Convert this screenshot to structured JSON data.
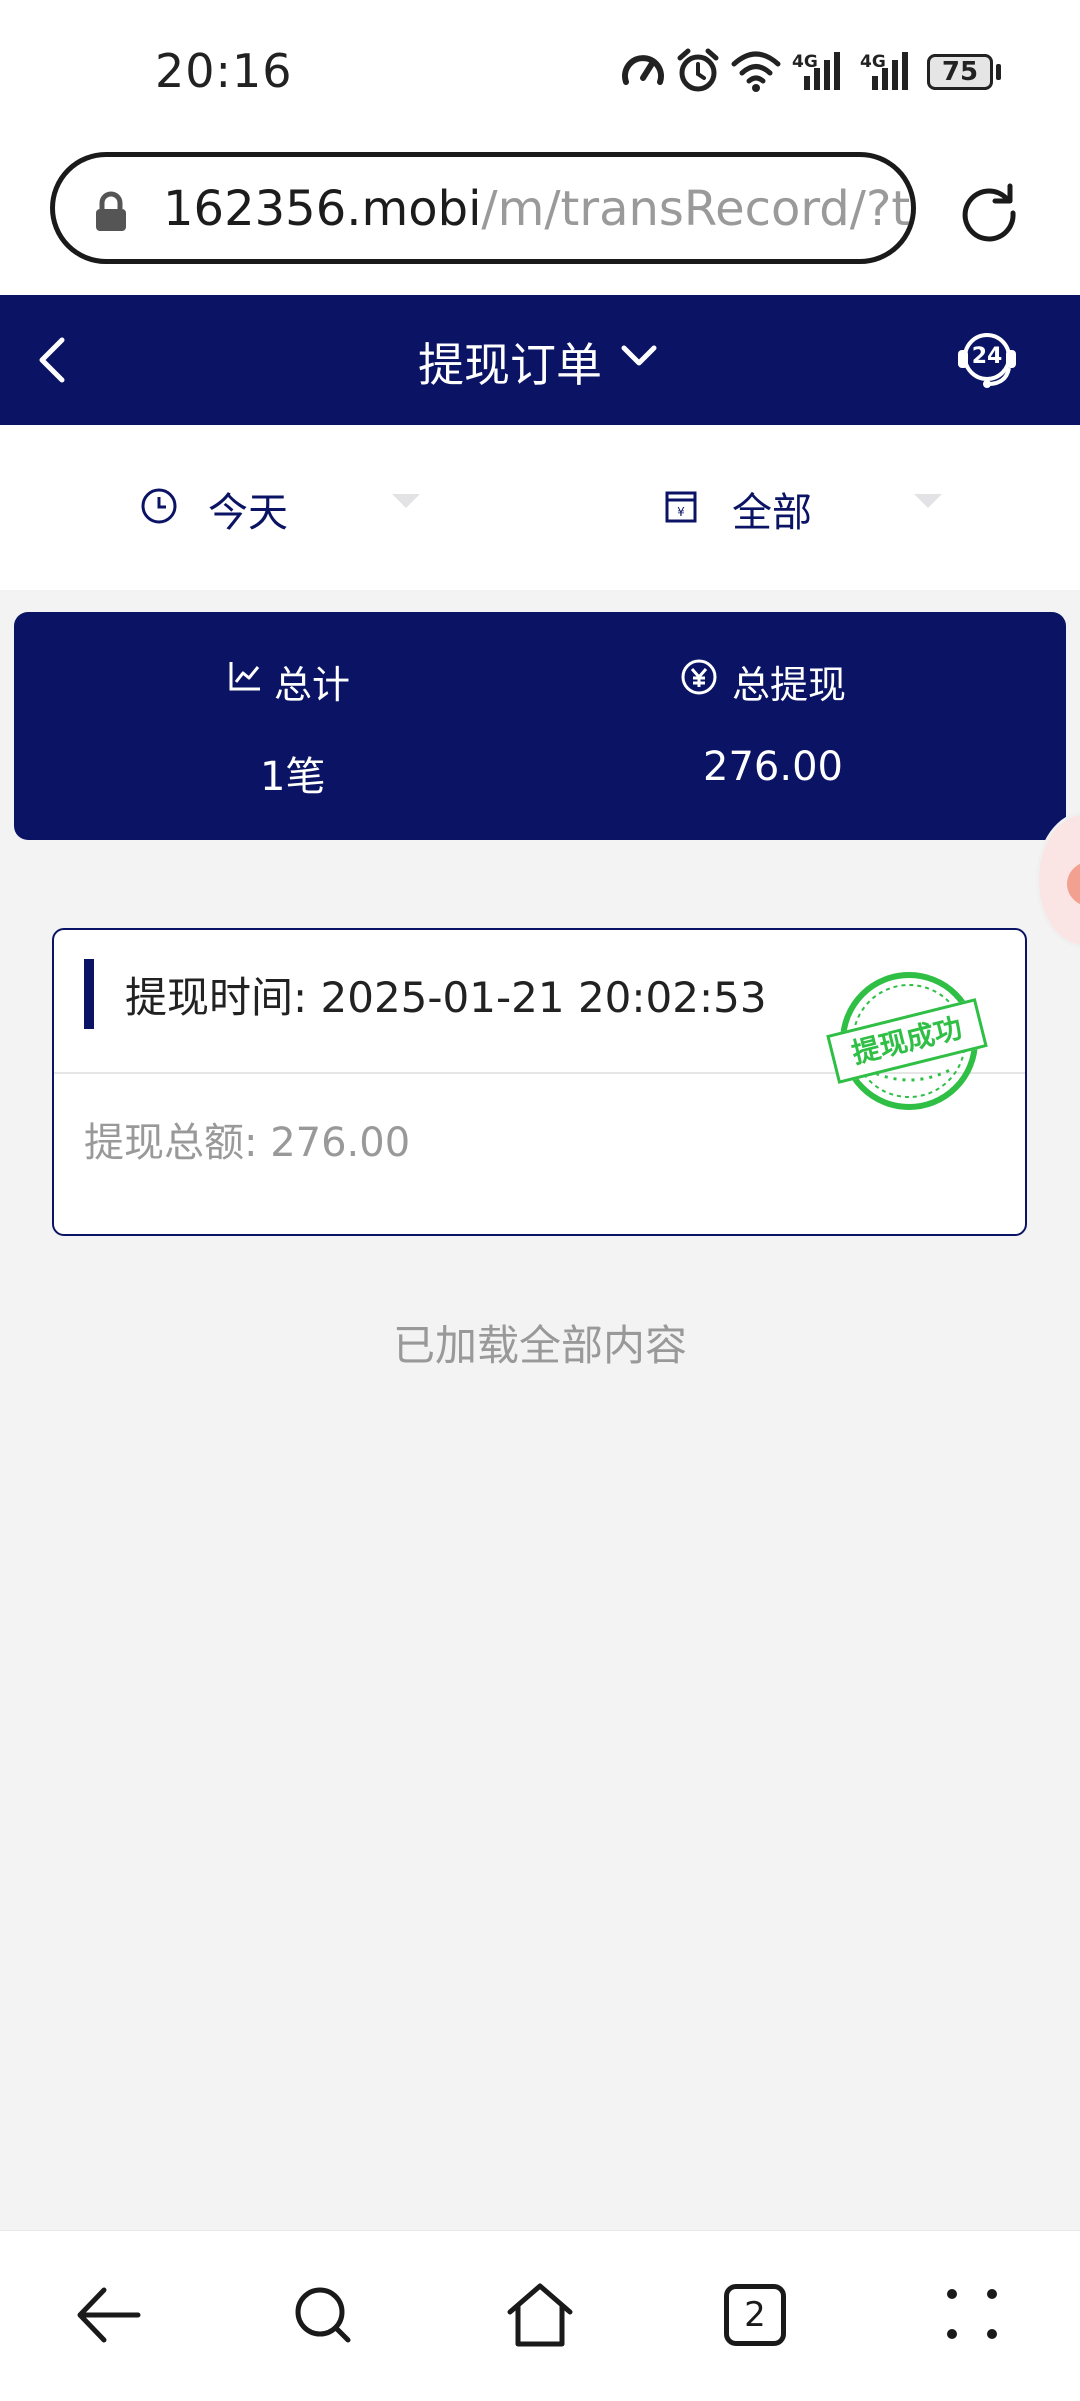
{
  "status_bar": {
    "time": "20:16",
    "network_1": "4G",
    "network_2": "4G",
    "battery": "75"
  },
  "browser": {
    "url_host": "162356.mobi",
    "url_path": "/m/transRecord/?type",
    "tab_count": "2"
  },
  "header": {
    "title": "提现订单",
    "support_badge": "24"
  },
  "filters": {
    "date_label": "今天",
    "type_label": "全部"
  },
  "summary": {
    "total_label": "总计",
    "total_value": "1笔",
    "amount_label": "总提现",
    "amount_value": "276.00"
  },
  "records": [
    {
      "time_label": "提现时间:",
      "time_value": "2025-01-21 20:02:53",
      "amount_label": "提现总额:",
      "amount_value": "276.00",
      "stamp_text": "提现成功"
    }
  ],
  "list_footer": "已加载全部内容",
  "colors": {
    "primary": "#0b1464",
    "stamp": "#2fbf45",
    "background": "#f3f3f4"
  }
}
